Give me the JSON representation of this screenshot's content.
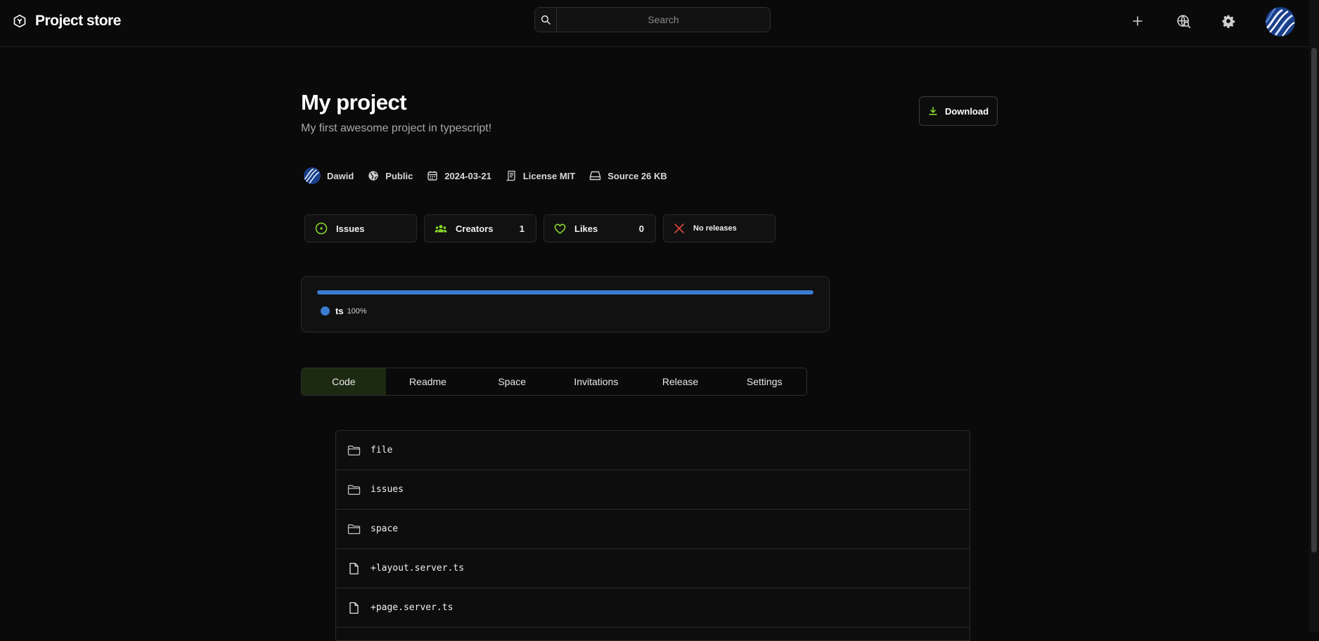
{
  "header": {
    "brand": "Project store",
    "search_placeholder": "Search"
  },
  "project": {
    "title": "My project",
    "description": "My first awesome project in typescript!",
    "download_label": "Download"
  },
  "meta": {
    "author": "Dawid",
    "visibility": "Public",
    "date": "2024-03-21",
    "license": "License MIT",
    "source": "Source 26 KB"
  },
  "stats": {
    "issues": {
      "label": "Issues"
    },
    "creators": {
      "label": "Creators",
      "count": "1"
    },
    "likes": {
      "label": "Likes",
      "count": "0"
    },
    "releases": {
      "label": "No releases"
    }
  },
  "languages": [
    {
      "name": "ts",
      "percent": "100%",
      "fraction": 1.0,
      "color": "#3a7cd0"
    }
  ],
  "tabs": [
    "Code",
    "Readme",
    "Space",
    "Invitations",
    "Release",
    "Settings"
  ],
  "active_tab": "Code",
  "files": [
    {
      "name": "file",
      "type": "folder"
    },
    {
      "name": "issues",
      "type": "folder"
    },
    {
      "name": "space",
      "type": "folder"
    },
    {
      "name": "+layout.server.ts",
      "type": "file"
    },
    {
      "name": "+page.server.ts",
      "type": "file"
    }
  ],
  "colors": {
    "accent_green": "#8bdb2a",
    "accent_red": "#e0463a",
    "language_blue": "#3a7cd0",
    "background": "#0a0a0a"
  },
  "icons": {
    "brand": "hexagon-logo-icon",
    "add": "plus-icon",
    "explore": "globe-search-icon",
    "settings": "gear-icon",
    "folder": "folder-icon",
    "file": "file-icon"
  }
}
